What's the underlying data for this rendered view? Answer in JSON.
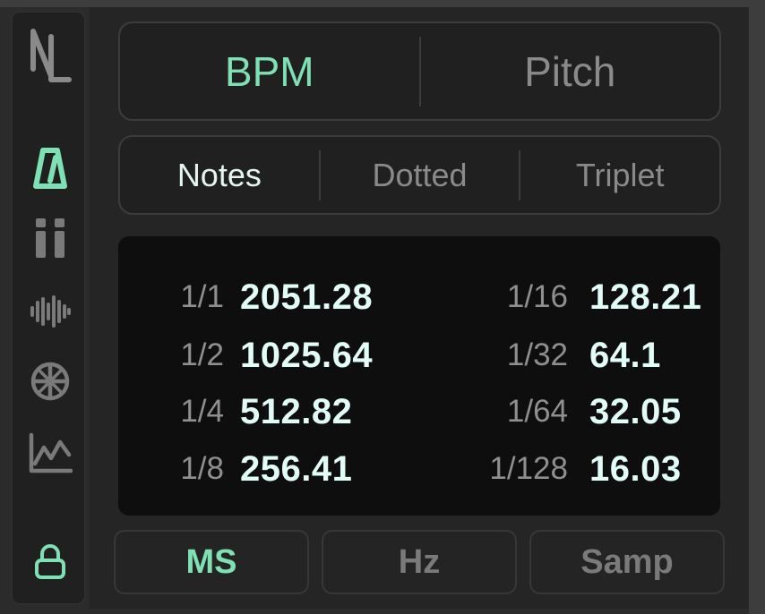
{
  "colors": {
    "accent": "#7ee0b4",
    "value_text": "#e2fcf8",
    "muted_text": "#8a8a8a",
    "display_bg": "#0e0e0e"
  },
  "sidebar": {
    "items": [
      {
        "icon": "logo-icon",
        "active": false
      },
      {
        "icon": "metronome-icon",
        "active": true
      },
      {
        "icon": "pause-bars-icon",
        "active": false
      },
      {
        "icon": "waveform-icon",
        "active": false
      },
      {
        "icon": "crosshair-wheel-icon",
        "active": false
      },
      {
        "icon": "line-chart-icon",
        "active": false
      },
      {
        "icon": "lock-icon",
        "active": true
      }
    ]
  },
  "mode_tabs": [
    {
      "label": "BPM",
      "active": true
    },
    {
      "label": "Pitch",
      "active": false
    }
  ],
  "note_tabs": [
    {
      "label": "Notes",
      "active": true
    },
    {
      "label": "Dotted",
      "active": false
    },
    {
      "label": "Triplet",
      "active": false
    }
  ],
  "values": {
    "left": [
      {
        "note": "1/1",
        "value": "2051.28"
      },
      {
        "note": "1/2",
        "value": "1025.64"
      },
      {
        "note": "1/4",
        "value": "512.82"
      },
      {
        "note": "1/8",
        "value": "256.41"
      }
    ],
    "right": [
      {
        "note": "1/16",
        "value": "128.21"
      },
      {
        "note": "1/32",
        "value": "64.1"
      },
      {
        "note": "1/64",
        "value": "32.05"
      },
      {
        "note": "1/128",
        "value": "16.03"
      }
    ]
  },
  "unit_buttons": [
    {
      "label": "MS",
      "active": true
    },
    {
      "label": "Hz",
      "active": false
    },
    {
      "label": "Samp",
      "active": false
    }
  ]
}
